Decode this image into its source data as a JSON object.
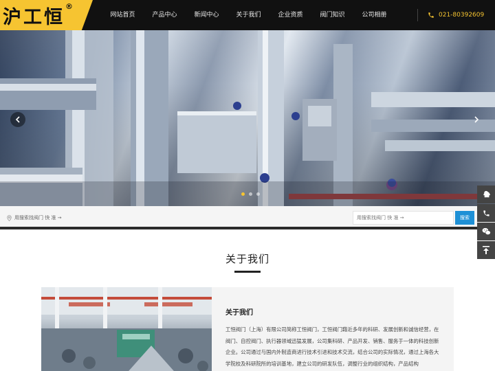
{
  "logo": {
    "text": "沪工恒",
    "reg": "®"
  },
  "nav": {
    "items": [
      "网站首页",
      "产品中心",
      "新闻中心",
      "关于我们",
      "企业资质",
      "阀门知识",
      "公司相册"
    ]
  },
  "phone": {
    "number": "021-80392609",
    "icon": "phone-icon"
  },
  "banner": {
    "slide_count": 3,
    "active_slide": 1
  },
  "search": {
    "hint": "用搜索找阀门 快 准 →",
    "placeholder": "用搜索找阀门 快 准 →",
    "button_label": "搜索"
  },
  "side_float": {
    "icons": [
      "qq-icon",
      "phone-icon",
      "wechat-icon",
      "back-to-top-icon"
    ]
  },
  "about": {
    "section_title": "关于我们",
    "heading": "关于我们",
    "text": "工恒阀门（上海）有限公司简称工恒阀门，工恒阀门藉近多年的科研、发展创新和诚信经营，在阀门、自控阀门、执行器领域迅猛发展，公司集科研、产品开发、销售、服务于一体的科技创新企业。公司通过与国内外制造商进行技术引进和技术交流，结合公司的实际情况，通过上海各大学院校及科研院所的培训基地，建立公司的研发队伍，调整行业的组织结构，产品结构"
  },
  "colors": {
    "accent": "#f6c431",
    "header_bg": "#111111",
    "search_button": "#1e90d6"
  }
}
